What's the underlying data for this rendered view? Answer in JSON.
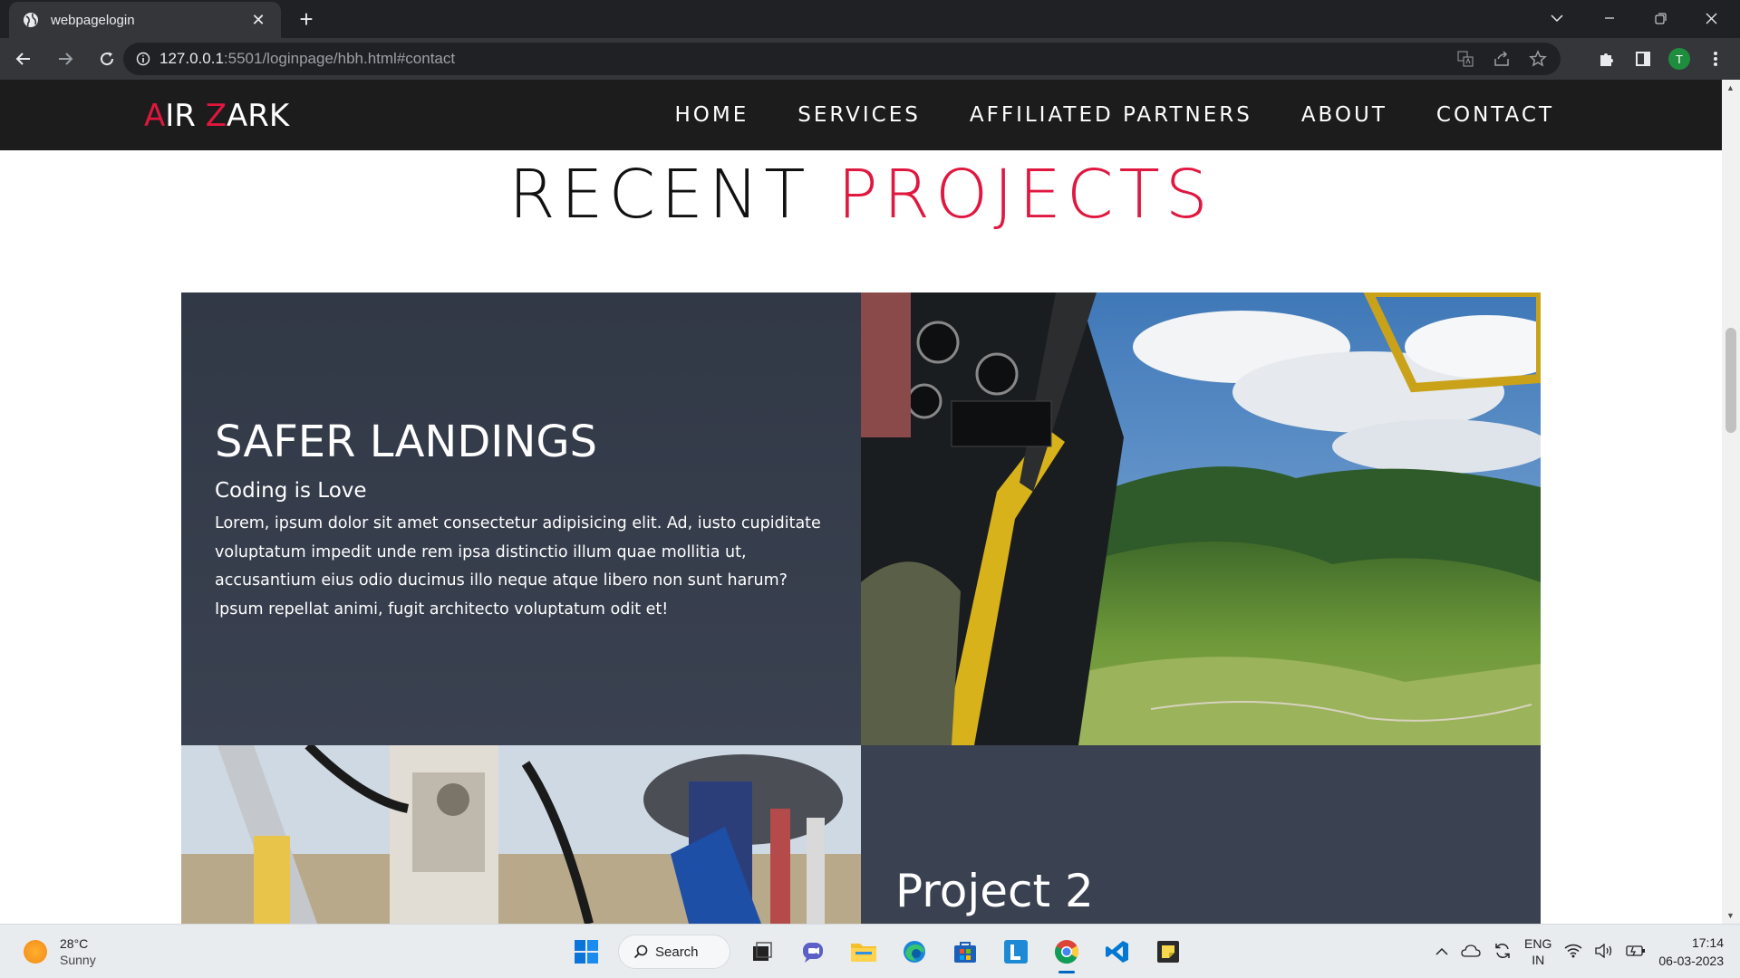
{
  "browser": {
    "tab_title": "webpagelogin",
    "url_host": "127.0.0.1",
    "url_rest": ":5501/loginpage/hbh.html#contact",
    "profile_initial": "T"
  },
  "site": {
    "logo_first_initial": "A",
    "logo_first_rest": "IR ",
    "logo_second_initial": "Z",
    "logo_second_rest": "ARK",
    "nav": [
      "HOME",
      "SERVICES",
      "AFFILIATED PARTNERS",
      "ABOUT",
      "CONTACT"
    ],
    "accent_color": "#e0173f"
  },
  "main": {
    "heading_plain": "RECENT",
    "heading_accent": "PROJECTS",
    "project1": {
      "title": "SAFER LANDINGS",
      "subtitle": "Coding is Love",
      "body": "Lorem, ipsum dolor sit amet consectetur adipisicing elit. Ad, iusto cupiditate voluptatum impedit unde rem ipsa distinctio illum quae mollitia ut, accusantium eius odio ducimus illo neque atque libero non sunt harum? Ipsum repellat animi, fugit architecto voluptatum odit et!"
    },
    "project2": {
      "title": "Project 2"
    }
  },
  "taskbar": {
    "weather_temp": "28°C",
    "weather_condition": "Sunny",
    "search_label": "Search",
    "lang_line1": "ENG",
    "lang_line2": "IN",
    "time": "17:14",
    "date": "06-03-2023"
  }
}
